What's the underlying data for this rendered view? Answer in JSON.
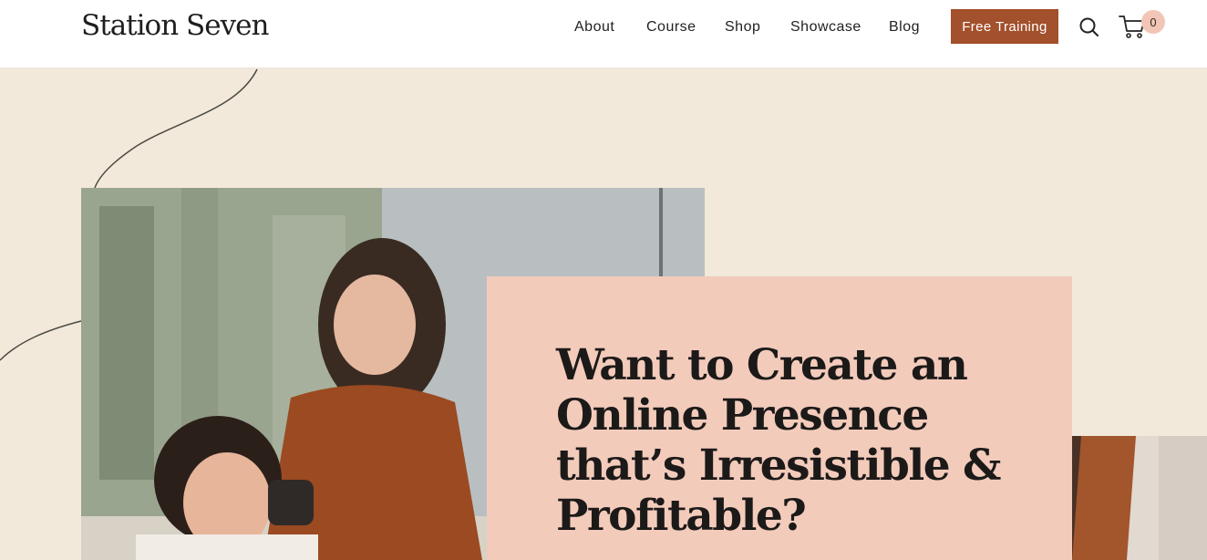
{
  "header": {
    "logo": "Station Seven",
    "nav": [
      {
        "label": "About"
      },
      {
        "label": "Course"
      },
      {
        "label": "Shop"
      },
      {
        "label": "Showcase"
      },
      {
        "label": "Blog"
      }
    ],
    "cta_label": "Free Training",
    "cart_count": "0",
    "icons": {
      "search": "search-icon",
      "cart": "cart-icon"
    }
  },
  "hero": {
    "title": "Want to Create an Online Presence that’s Irresistible & Profitable?"
  },
  "colors": {
    "background": "#f2e9da",
    "cta": "#a3502c",
    "card": "#f3cbbb",
    "badge": "#f1c6b6"
  }
}
